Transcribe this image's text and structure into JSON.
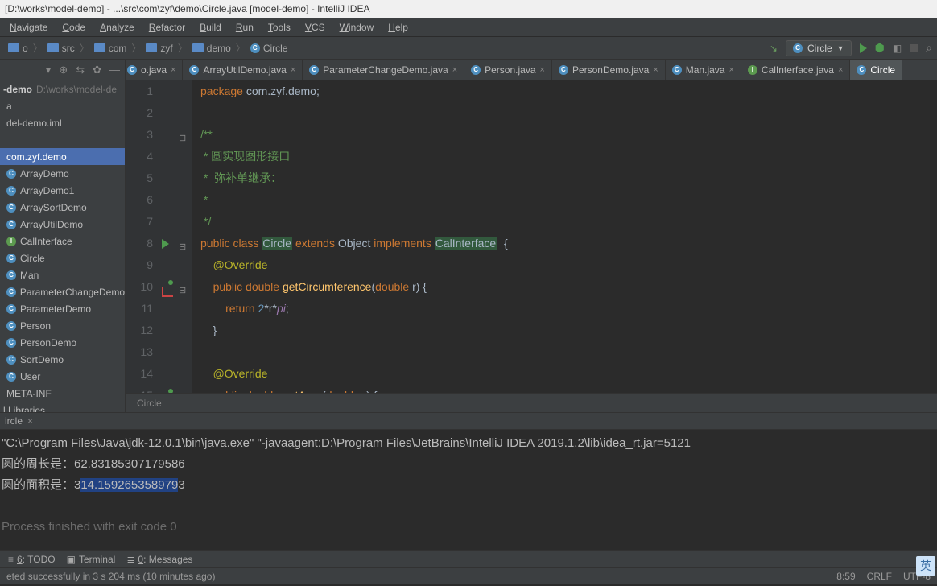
{
  "title": "[D:\\works\\model-demo] - ...\\src\\com\\zyf\\demo\\Circle.java [model-demo] - IntelliJ IDEA",
  "menus": [
    "Navigate",
    "Code",
    "Analyze",
    "Refactor",
    "Build",
    "Run",
    "Tools",
    "VCS",
    "Window",
    "Help"
  ],
  "breadcrumbs": {
    "parts": [
      {
        "icon": "folder",
        "text": "o"
      },
      {
        "icon": "folder",
        "text": "src"
      },
      {
        "icon": "folder",
        "text": "com"
      },
      {
        "icon": "folder",
        "text": "zyf"
      },
      {
        "icon": "folder",
        "text": "demo"
      },
      {
        "icon": "class",
        "text": "Circle"
      }
    ]
  },
  "runConfig": "Circle",
  "sidebar": {
    "project": {
      "name": "-demo",
      "path": "D:\\works\\model-de"
    },
    "items": [
      "a",
      "del-demo.iml",
      "",
      "com.zyf.demo",
      "ArrayDemo",
      "ArrayDemo1",
      "ArraySortDemo",
      "ArrayUtilDemo",
      "CalInterface",
      "Circle",
      "Man",
      "ParameterChangeDemo",
      "ParameterDemo",
      "Person",
      "PersonDemo",
      "SortDemo",
      "User",
      "META-INF"
    ],
    "libs": "l Libraries"
  },
  "tabs": [
    {
      "label": "o.java",
      "icon": "class",
      "trunc": true
    },
    {
      "label": "ArrayUtilDemo.java",
      "icon": "class"
    },
    {
      "label": "ParameterChangeDemo.java",
      "icon": "class"
    },
    {
      "label": "Person.java",
      "icon": "class"
    },
    {
      "label": "PersonDemo.java",
      "icon": "class"
    },
    {
      "label": "Man.java",
      "icon": "class"
    },
    {
      "label": "CalInterface.java",
      "icon": "iface"
    },
    {
      "label": "Circle",
      "icon": "class",
      "active": true,
      "trunc_r": true
    }
  ],
  "code": {
    "lines": [
      {
        "n": 1,
        "t": [
          [
            "kw",
            "package "
          ],
          [
            "",
            "com.zyf.demo"
          ],
          [
            "",
            ";"
          ]
        ]
      },
      {
        "n": 2,
        "t": []
      },
      {
        "n": 3,
        "fold": "-",
        "t": [
          [
            "cmt-doc",
            "/**"
          ]
        ]
      },
      {
        "n": 4,
        "t": [
          [
            "cmt-doc",
            " * 圆实现图形接口"
          ]
        ]
      },
      {
        "n": 5,
        "t": [
          [
            "cmt-doc",
            " *  弥补单继承："
          ]
        ]
      },
      {
        "n": 6,
        "t": [
          [
            "cmt-doc",
            " *"
          ]
        ]
      },
      {
        "n": 7,
        "t": [
          [
            "cmt-doc",
            " */"
          ]
        ]
      },
      {
        "n": 8,
        "play": true,
        "fold": "-",
        "t": [
          [
            "kw",
            "public class "
          ],
          [
            "hl-class",
            "Circle"
          ],
          [
            "",
            " "
          ],
          [
            "kw",
            "extends"
          ],
          [
            "",
            " Object "
          ],
          [
            "kw",
            "implements"
          ],
          [
            "",
            " "
          ],
          [
            "hl-iface",
            "CalInterface"
          ],
          [
            "cursor",
            ""
          ],
          [
            "",
            "  {"
          ]
        ]
      },
      {
        "n": 9,
        "t": [
          [
            "",
            "    "
          ],
          [
            "ann",
            "@Override"
          ]
        ]
      },
      {
        "n": 10,
        "impl": true,
        "fold": "-",
        "t": [
          [
            "",
            "    "
          ],
          [
            "kw",
            "public double "
          ],
          [
            "fn",
            "getCircumference"
          ],
          [
            "",
            "("
          ],
          [
            "kw",
            "double"
          ],
          [
            "",
            " r) {"
          ]
        ]
      },
      {
        "n": 11,
        "t": [
          [
            "",
            "        "
          ],
          [
            "kw",
            "return "
          ],
          [
            "num",
            "2"
          ],
          [
            "",
            "*r*"
          ],
          [
            "ital",
            "pi"
          ],
          [
            "",
            ";"
          ]
        ]
      },
      {
        "n": 12,
        "t": [
          [
            "",
            "    }"
          ]
        ]
      },
      {
        "n": 13,
        "t": []
      },
      {
        "n": 14,
        "t": [
          [
            "",
            "    "
          ],
          [
            "ann",
            "@Override"
          ]
        ]
      },
      {
        "n": 15,
        "impl": true,
        "fold": "-",
        "t": [
          [
            "",
            "    "
          ],
          [
            "kw",
            "public double "
          ],
          [
            "fn",
            "getArea"
          ],
          [
            "",
            "("
          ],
          [
            "kw",
            "double"
          ],
          [
            "",
            " r) {"
          ]
        ]
      }
    ]
  },
  "breadcrumb2": "Circle",
  "runTab": {
    "label": "ircle"
  },
  "console": {
    "cmd": "\"C:\\Program Files\\Java\\jdk-12.0.1\\bin\\java.exe\" \"-javaagent:D:\\Program Files\\JetBrains\\IntelliJ IDEA 2019.1.2\\lib\\idea_rt.jar=5121",
    "l1_pre": "圆的周长是：6",
    "l1_body": "2.83185307179586",
    "l2_pre": "圆的面积是：3",
    "l2_sel": "14.159265358979",
    "l2_post": "3",
    "exit": "Process finished with exit code 0"
  },
  "toolwindows": {
    "todo": "6: TODO",
    "terminal": "Terminal",
    "messages": "0: Messages"
  },
  "status": {
    "msg": "eted successfully in 3 s 204 ms (10 minutes ago)",
    "pos": "8:59",
    "lf": "CRLF",
    "enc": "UTF-8"
  },
  "ime": "英"
}
